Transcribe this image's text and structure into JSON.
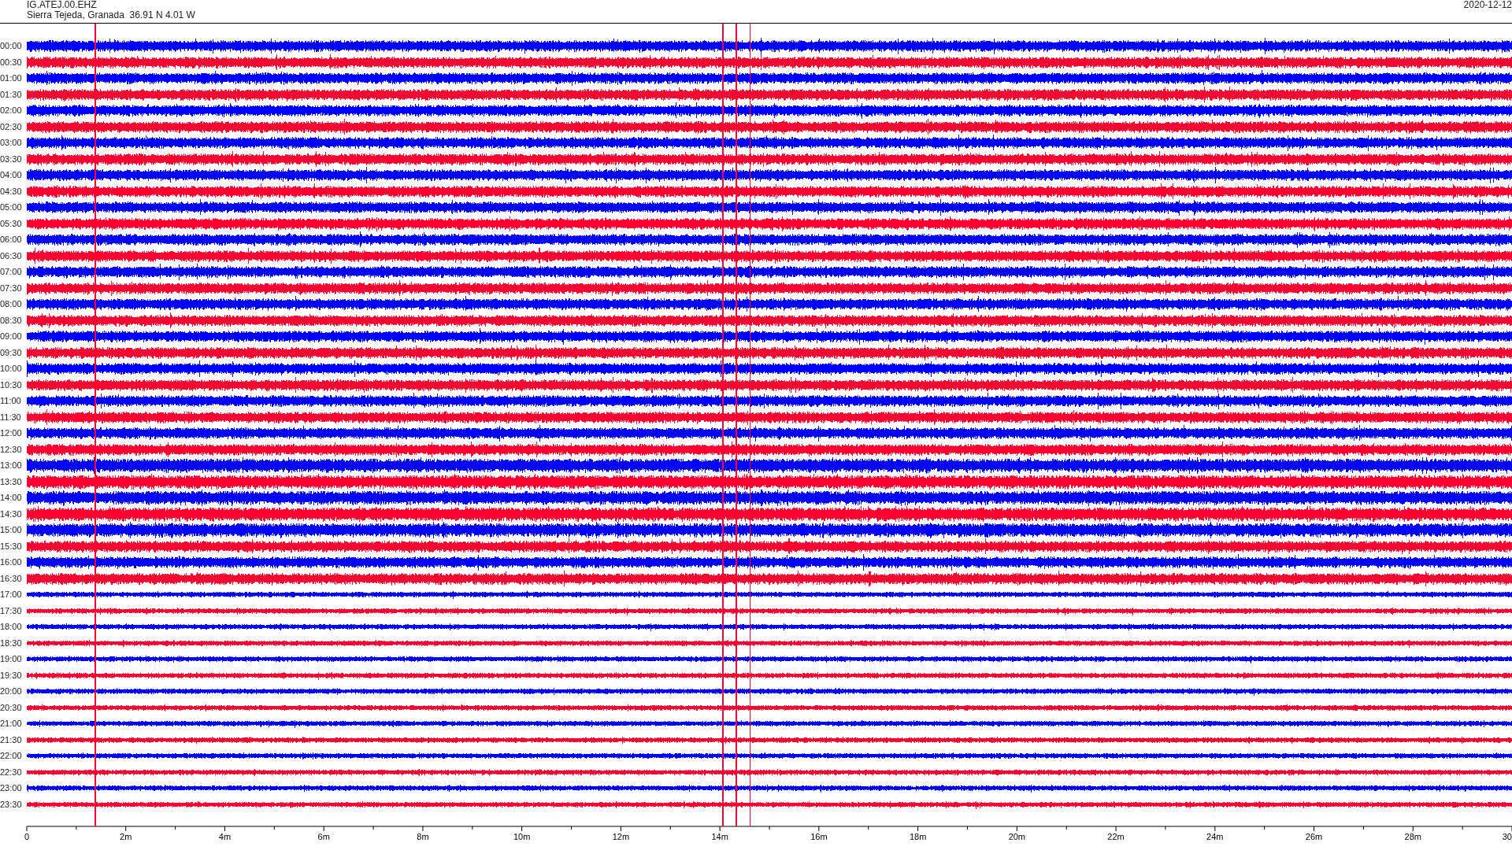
{
  "header": {
    "station": "IG.ATEJ.00.EHZ",
    "location": "Sierra Tejeda, Granada  36.91 N 4.01 W",
    "date": "2020-12-12"
  },
  "rows": [
    {
      "label": "00:00",
      "color": "#0000ff"
    },
    {
      "label": "00:30",
      "color": "#ff0033"
    },
    {
      "label": "01:00",
      "color": "#0000ff"
    },
    {
      "label": "01:30",
      "color": "#ff0033"
    },
    {
      "label": "02:00",
      "color": "#0000ff"
    },
    {
      "label": "02:30",
      "color": "#ff0033"
    },
    {
      "label": "03:00",
      "color": "#0000ff"
    },
    {
      "label": "03:30",
      "color": "#ff0033"
    },
    {
      "label": "04:00",
      "color": "#0000ff"
    },
    {
      "label": "04:30",
      "color": "#ff0033"
    },
    {
      "label": "05:00",
      "color": "#0000ff"
    },
    {
      "label": "05:30",
      "color": "#ff0033"
    },
    {
      "label": "06:00",
      "color": "#0000ff"
    },
    {
      "label": "06:30",
      "color": "#ff0033"
    },
    {
      "label": "07:00",
      "color": "#0000ff"
    },
    {
      "label": "07:30",
      "color": "#ff0033"
    },
    {
      "label": "08:00",
      "color": "#0000ff"
    },
    {
      "label": "08:30",
      "color": "#ff0033"
    },
    {
      "label": "09:00",
      "color": "#0000ff"
    },
    {
      "label": "09:30",
      "color": "#ff0033"
    },
    {
      "label": "10:00",
      "color": "#0000ff"
    },
    {
      "label": "10:30",
      "color": "#ff0033"
    },
    {
      "label": "11:00",
      "color": "#0000ff"
    },
    {
      "label": "11:30",
      "color": "#ff0033"
    },
    {
      "label": "12:00",
      "color": "#0000ff"
    },
    {
      "label": "12:30",
      "color": "#ff0033"
    },
    {
      "label": "13:00",
      "color": "#0000ff"
    },
    {
      "label": "13:30",
      "color": "#ff0033"
    },
    {
      "label": "14:00",
      "color": "#0000ff"
    },
    {
      "label": "14:30",
      "color": "#ff0033"
    },
    {
      "label": "15:00",
      "color": "#0000ff"
    },
    {
      "label": "15:30",
      "color": "#ff0033"
    },
    {
      "label": "16:00",
      "color": "#0000ff"
    },
    {
      "label": "16:30",
      "color": "#ff0033"
    },
    {
      "label": "17:00",
      "color": "#0000ff"
    },
    {
      "label": "17:30",
      "color": "#ff0033"
    },
    {
      "label": "18:00",
      "color": "#0000ff"
    },
    {
      "label": "18:30",
      "color": "#ff0033"
    },
    {
      "label": "19:00",
      "color": "#0000ff"
    },
    {
      "label": "19:30",
      "color": "#ff0033"
    },
    {
      "label": "20:00",
      "color": "#0000ff"
    },
    {
      "label": "20:30",
      "color": "#ff0033"
    },
    {
      "label": "21:00",
      "color": "#0000ff"
    },
    {
      "label": "21:30",
      "color": "#ff0033"
    },
    {
      "label": "22:00",
      "color": "#0000ff"
    },
    {
      "label": "22:30",
      "color": "#ff0033"
    },
    {
      "label": "23:00",
      "color": "#0000ff"
    },
    {
      "label": "23:30",
      "color": "#ff0033"
    }
  ],
  "x_axis": {
    "ticks": [
      "0",
      "2m",
      "4m",
      "6m",
      "8m",
      "10m",
      "12m",
      "14m",
      "16m",
      "18m",
      "20m",
      "22m",
      "24m",
      "26m",
      "28m",
      "30"
    ]
  }
}
